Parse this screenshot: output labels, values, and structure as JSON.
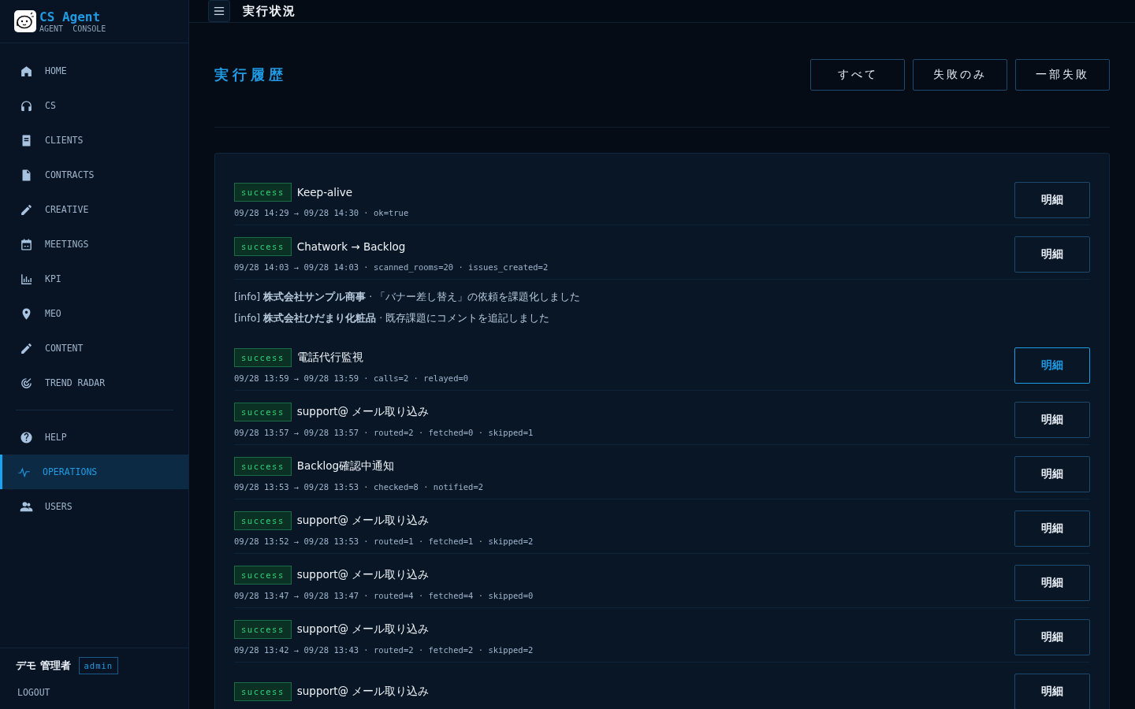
{
  "brand": {
    "name": "CS Agent",
    "subtitle": "AGENT  CONSOLE"
  },
  "nav_main": [
    {
      "label": "HOME",
      "selected": false
    },
    {
      "label": "CS",
      "selected": false
    },
    {
      "label": "CLIENTS",
      "selected": false
    },
    {
      "label": "CONTRACTS",
      "selected": false
    },
    {
      "label": "CREATIVE",
      "selected": false
    },
    {
      "label": "MEETINGS",
      "selected": false
    },
    {
      "label": "KPI",
      "selected": false
    },
    {
      "label": "MEO",
      "selected": false
    },
    {
      "label": "CONTENT",
      "selected": false
    },
    {
      "label": "TREND RADAR",
      "selected": false
    }
  ],
  "nav_secondary": [
    {
      "label": "HELP",
      "selected": false
    },
    {
      "label": "OPERATIONS",
      "selected": true
    },
    {
      "label": "USERS",
      "selected": false
    }
  ],
  "user": {
    "name": "デモ 管理者",
    "role": "admin",
    "logout": "LOGOUT"
  },
  "header": {
    "title": "実行状況"
  },
  "page_title": "実行履歴",
  "filters": [
    {
      "label": "すべて",
      "selected": false
    },
    {
      "label": "失敗のみ",
      "selected": false
    },
    {
      "label": "一部失敗",
      "selected": false
    }
  ],
  "runs": [
    {
      "status": "success",
      "title": "Keep-alive",
      "meta": "09/28 14:29 → 09/28 14:30 · ok=true",
      "button": "明細",
      "focused": false
    },
    {
      "status": "success",
      "title": "Chatwork → Backlog",
      "meta": "09/28 14:03 → 09/28 14:03 · scanned_rooms=20 · issues_created=2",
      "button": "明細",
      "focused": false,
      "logs": [
        "[info] **株式会社サンプル商事** · 「バナー差し替え」の依頼を課題化しました",
        "[info] **株式会社ひだまり化粧品** · 既存課題にコメントを追記しました"
      ]
    },
    {
      "status": "success",
      "title": "電話代行監視",
      "meta": "09/28 13:59 → 09/28 13:59 · calls=2 · relayed=0",
      "button": "明細",
      "focused": true
    },
    {
      "status": "success",
      "title": "support@ メール取り込み",
      "meta": "09/28 13:57 → 09/28 13:57 · routed=2 · fetched=0 · skipped=1",
      "button": "明細",
      "focused": false
    },
    {
      "status": "success",
      "title": "Backlog確認中通知",
      "meta": "09/28 13:53 → 09/28 13:53 · checked=8 · notified=2",
      "button": "明細",
      "focused": false
    },
    {
      "status": "success",
      "title": "support@ メール取り込み",
      "meta": "09/28 13:52 → 09/28 13:53 · routed=1 · fetched=1 · skipped=2",
      "button": "明細",
      "focused": false
    },
    {
      "status": "success",
      "title": "support@ メール取り込み",
      "meta": "09/28 13:47 → 09/28 13:47 · routed=4 · fetched=4 · skipped=0",
      "button": "明細",
      "focused": false
    },
    {
      "status": "success",
      "title": "support@ メール取り込み",
      "meta": "09/28 13:42 → 09/28 13:43 · routed=2 · fetched=2 · skipped=2",
      "button": "明細",
      "focused": false
    },
    {
      "status": "success",
      "title": "support@ メール取り込み",
      "button": "明細",
      "focused": false
    }
  ]
}
